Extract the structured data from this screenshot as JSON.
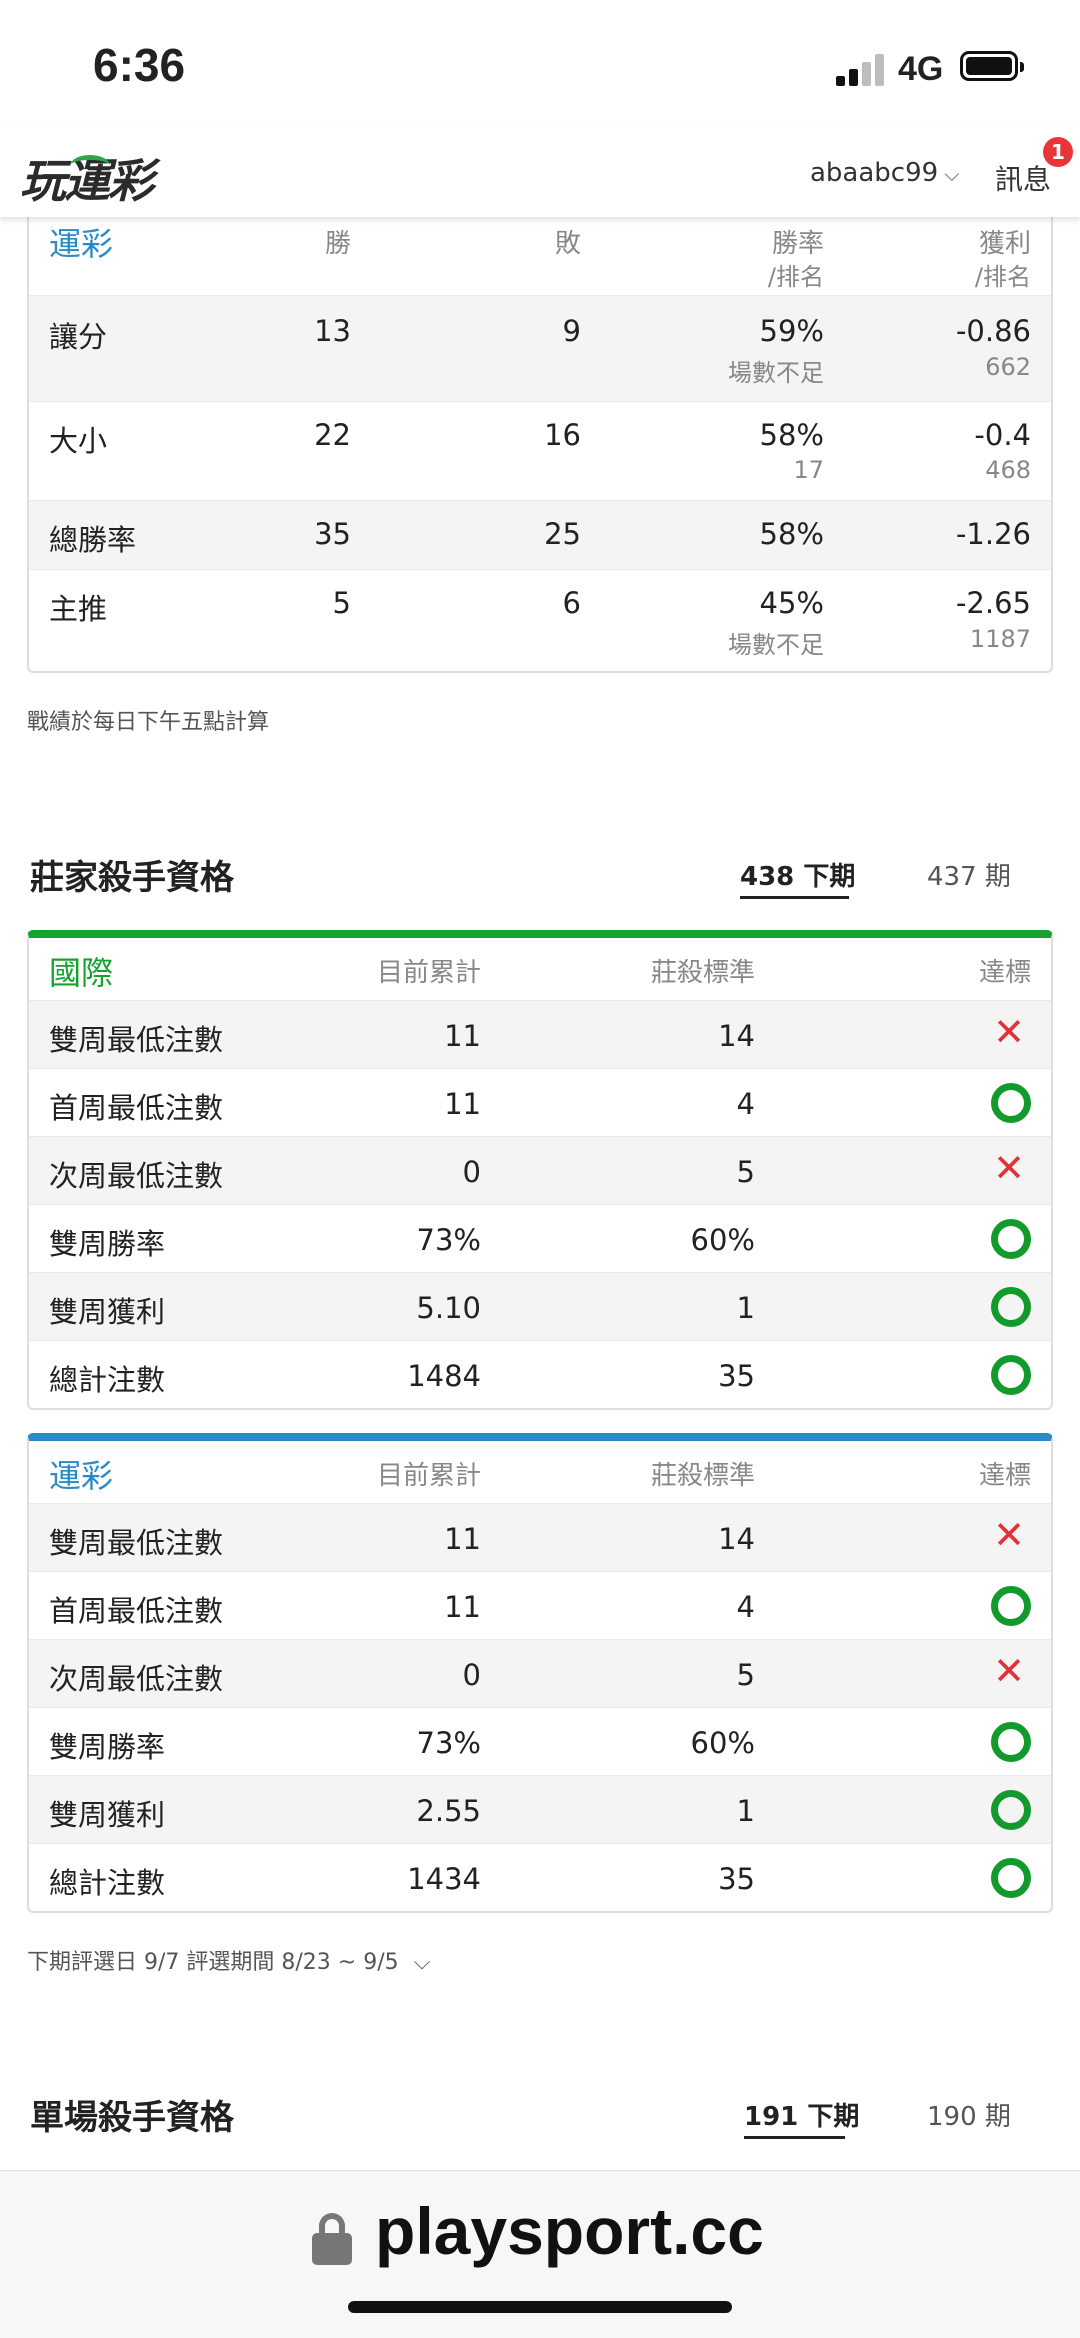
{
  "status": {
    "time": "6:36",
    "network": "4G"
  },
  "header": {
    "logo": "玩運彩",
    "username": "abaabc99",
    "messages_label": "訊息",
    "messages_badge": "1"
  },
  "record_table": {
    "header": [
      "運彩",
      "勝",
      "敗",
      "勝率",
      "/排名",
      "獲利",
      "/排名"
    ],
    "rows": [
      {
        "label": "讓分",
        "win": "13",
        "lose": "9",
        "rate": "59%",
        "rate_rank": "場數不足",
        "profit": "-0.86",
        "profit_rank": "662"
      },
      {
        "label": "大小",
        "win": "22",
        "lose": "16",
        "rate": "58%",
        "rate_rank": "17",
        "profit": "-0.4",
        "profit_rank": "468"
      },
      {
        "label": "總勝率",
        "win": "35",
        "lose": "25",
        "rate": "58%",
        "rate_rank": "",
        "profit": "-1.26",
        "profit_rank": ""
      },
      {
        "label": "主推",
        "win": "5",
        "lose": "6",
        "rate": "45%",
        "rate_rank": "場數不足",
        "profit": "-2.65",
        "profit_rank": "1187"
      }
    ],
    "note": "戰績於每日下午五點計算"
  },
  "banker_section": {
    "title": "莊家殺手資格",
    "periods": [
      "438 下期",
      "437 期"
    ],
    "tables": [
      {
        "title": "國際",
        "accent": "#14a32e",
        "columns": [
          "目前累計",
          "莊殺標準",
          "達標"
        ],
        "rows": [
          {
            "label": "雙周最低注數",
            "current": "11",
            "standard": "14",
            "met": false
          },
          {
            "label": "首周最低注數",
            "current": "11",
            "standard": "4",
            "met": true
          },
          {
            "label": "次周最低注數",
            "current": "0",
            "standard": "5",
            "met": false
          },
          {
            "label": "雙周勝率",
            "current": "73%",
            "standard": "60%",
            "met": true
          },
          {
            "label": "雙周獲利",
            "current": "5.10",
            "standard": "1",
            "met": true
          },
          {
            "label": "總計注數",
            "current": "1484",
            "standard": "35",
            "met": true
          }
        ]
      },
      {
        "title": "運彩",
        "accent": "#2a8ac8",
        "columns": [
          "目前累計",
          "莊殺標準",
          "達標"
        ],
        "rows": [
          {
            "label": "雙周最低注數",
            "current": "11",
            "standard": "14",
            "met": false
          },
          {
            "label": "首周最低注數",
            "current": "11",
            "standard": "4",
            "met": true
          },
          {
            "label": "次周最低注數",
            "current": "0",
            "standard": "5",
            "met": false
          },
          {
            "label": "雙周勝率",
            "current": "73%",
            "standard": "60%",
            "met": true
          },
          {
            "label": "雙周獲利",
            "current": "2.55",
            "standard": "1",
            "met": true
          },
          {
            "label": "總計注數",
            "current": "1434",
            "standard": "35",
            "met": true
          }
        ]
      }
    ],
    "note": "下期評選日 9/7 評選期間 8/23 ~ 9/5"
  },
  "single_section": {
    "title": "單場殺手資格",
    "periods": [
      "191 下期",
      "190 期"
    ]
  },
  "browser": {
    "url": "playsport.cc"
  }
}
